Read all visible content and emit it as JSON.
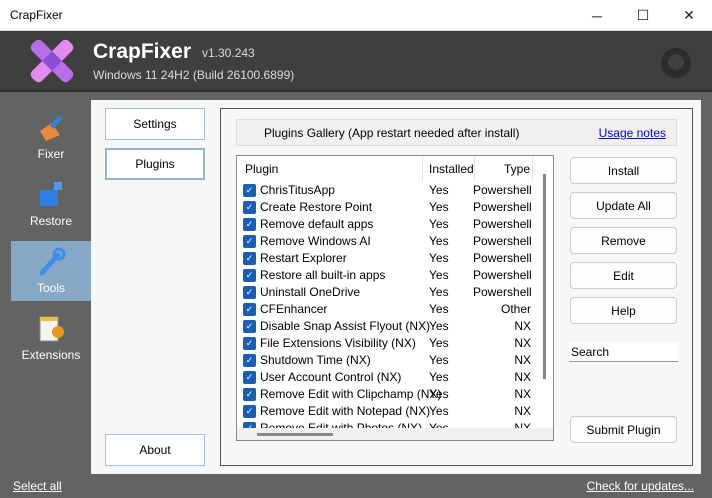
{
  "window": {
    "title": "CrapFixer",
    "minimize": "─",
    "maximize": "☐",
    "close": "✕"
  },
  "header": {
    "app_name": "CrapFixer",
    "version": "v1.30.243",
    "os": "Windows 11 24H2 (Build 26100.6899)"
  },
  "sidebar": {
    "items": [
      {
        "label": "Fixer",
        "icon": "broom-icon"
      },
      {
        "label": "Restore",
        "icon": "registry-cubes-icon"
      },
      {
        "label": "Tools",
        "icon": "wrench-icon",
        "selected": true
      },
      {
        "label": "Extensions",
        "icon": "notepad-gear-icon"
      }
    ]
  },
  "nav": {
    "settings": "Settings",
    "plugins": "Plugins",
    "about": "About"
  },
  "gallery": {
    "title": "Plugins Gallery (App restart needed after install)",
    "usage_notes": "Usage notes",
    "columns": [
      "Plugin",
      "Installed",
      "Type"
    ],
    "rows": [
      {
        "name": "ChrisTitusApp",
        "installed": "Yes",
        "type": "Powershell"
      },
      {
        "name": "Create Restore Point",
        "installed": "Yes",
        "type": "Powershell"
      },
      {
        "name": "Remove default apps",
        "installed": "Yes",
        "type": "Powershell"
      },
      {
        "name": "Remove Windows AI",
        "installed": "Yes",
        "type": "Powershell"
      },
      {
        "name": "Restart Explorer",
        "installed": "Yes",
        "type": "Powershell"
      },
      {
        "name": "Restore all built-in apps",
        "installed": "Yes",
        "type": "Powershell"
      },
      {
        "name": "Uninstall OneDrive",
        "installed": "Yes",
        "type": "Powershell"
      },
      {
        "name": "CFEnhancer",
        "installed": "Yes",
        "type": "Other"
      },
      {
        "name": "Disable Snap Assist Flyout (NX)",
        "installed": "Yes",
        "type": "NX"
      },
      {
        "name": "File Extensions Visibility (NX)",
        "installed": "Yes",
        "type": "NX"
      },
      {
        "name": "Shutdown Time (NX)",
        "installed": "Yes",
        "type": "NX"
      },
      {
        "name": "User Account Control (NX)",
        "installed": "Yes",
        "type": "NX"
      },
      {
        "name": "Remove Edit with Clipchamp (NX)",
        "installed": "Yes",
        "type": "NX"
      },
      {
        "name": "Remove Edit with Notepad (NX)",
        "installed": "Yes",
        "type": "NX"
      },
      {
        "name": "Remove Edit with Photos (NX)",
        "installed": "Yes",
        "type": "NX"
      }
    ]
  },
  "actions": {
    "install": "Install",
    "update_all": "Update All",
    "remove": "Remove",
    "edit": "Edit",
    "help": "Help",
    "search_value": "Search",
    "submit": "Submit Plugin"
  },
  "footer": {
    "select_all": "Select all",
    "check_updates": "Check for updates..."
  }
}
